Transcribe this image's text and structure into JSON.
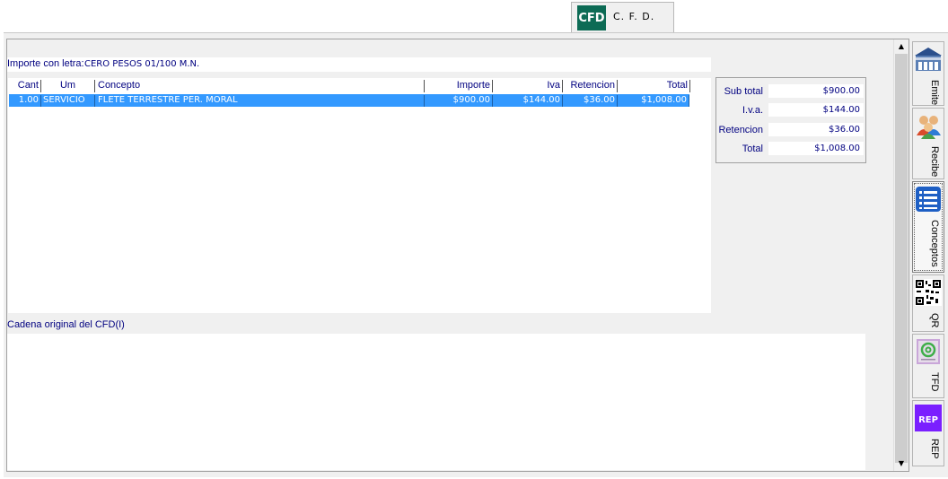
{
  "tab": {
    "logo": "CFD",
    "label": "C. F. D."
  },
  "importe": {
    "label": "Importe con letra:",
    "value": "CERO PESOS 01/100 M.N."
  },
  "grid": {
    "headers": [
      "Cant",
      "Um",
      "Concepto",
      "Importe",
      "Iva",
      "Retencion",
      "Total"
    ],
    "rows": [
      [
        "1.00",
        "SERVICIO",
        "FLETE TERRESTRE PER. MORAL",
        "$900.00",
        "$144.00",
        "$36.00",
        "$1,008.00"
      ]
    ]
  },
  "totals": {
    "subtotal_label": "Sub total",
    "subtotal": "$900.00",
    "iva_label": "I.v.a.",
    "iva": "$144.00",
    "ret_label": "Retencion",
    "ret": "$36.00",
    "total_label": "Total",
    "total": "$1,008.00"
  },
  "cadena": {
    "label": "Cadena original del CFD(I)",
    "value": ""
  },
  "sidebar": {
    "items": [
      {
        "label": "Emite",
        "icon": "building-icon"
      },
      {
        "label": "Recibe",
        "icon": "people-icon"
      },
      {
        "label": "Conceptos",
        "icon": "list-icon"
      },
      {
        "label": "QR",
        "icon": "qr-code-icon"
      },
      {
        "label": "TFD",
        "icon": "stamp-icon"
      },
      {
        "label": "REP",
        "icon": "rep-icon"
      }
    ]
  },
  "colors": {
    "selection": "#3399ff",
    "label_blue": "#000080",
    "cfd_green": "#0d6b55",
    "rep_purple": "#7a1fff"
  }
}
